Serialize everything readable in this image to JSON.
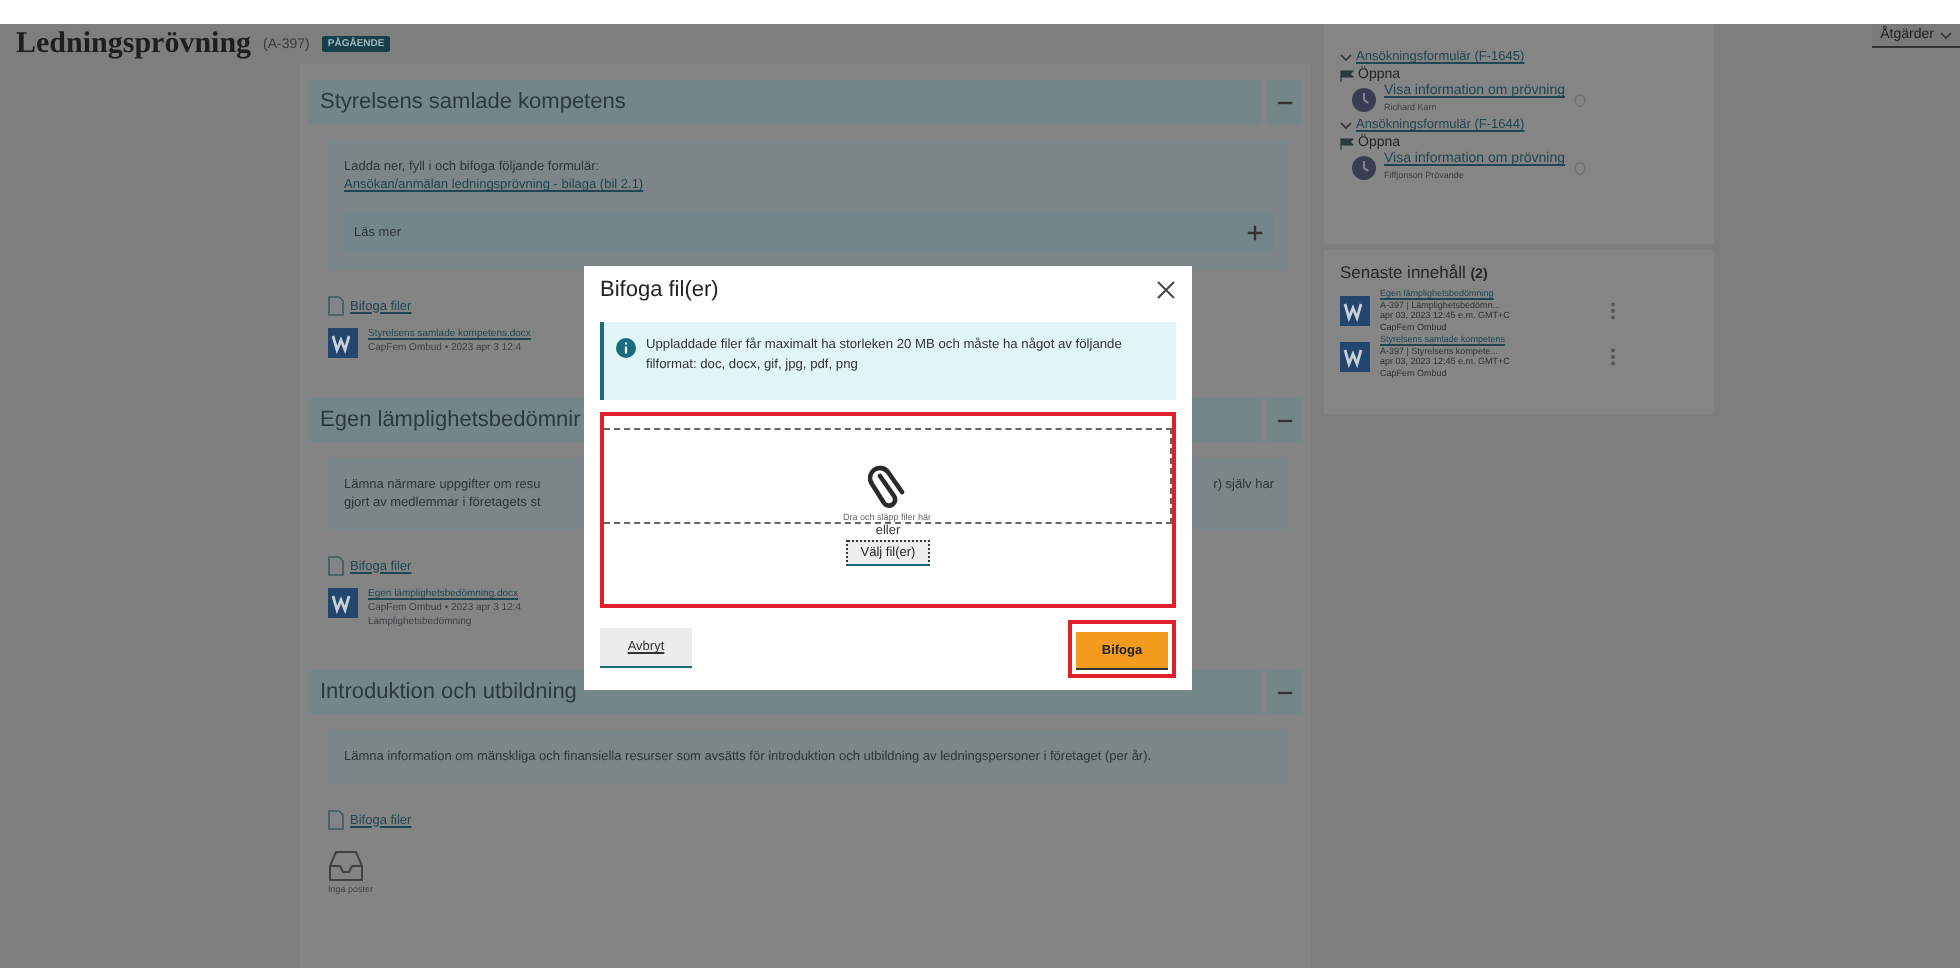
{
  "header": {
    "title": "Ledningsprövning",
    "code": "(A-397)",
    "badge": "PÅGÅENDE"
  },
  "actions_button": {
    "label": "Åtgärder"
  },
  "sections": [
    {
      "heading": "Styrelsens samlade kompetens",
      "expanded": true,
      "description": [
        "Ladda ner, fyll i och bifoga följande formulär:"
      ],
      "form_link": "Ansökan/anmälan ledningsprövning - bilaga (bil 2.1)",
      "read_more": {
        "label": "Läs mer",
        "expanded": false
      },
      "attach": "Bifoga filer",
      "files": [
        {
          "name": "Styrelsens samlade kompetens.docx",
          "meta": "CapFem Ombud •  2023 apr 3 12:4"
        }
      ]
    },
    {
      "heading": "Egen lämplighetsbedömnir",
      "expanded": true,
      "description": [
        "Lämna närmare uppgifter om resu",
        "gjort av medlemmar i företagets st"
      ],
      "description_right": "r) själv har",
      "attach": "Bifoga filer",
      "files": [
        {
          "name": "Egen lämplighetsbedömning.docx",
          "meta": "CapFem Ombud •  2023 apr 3 12:4",
          "category": "Lämplighetsbedömning"
        }
      ]
    },
    {
      "heading": "Introduktion och utbildning",
      "expanded": true,
      "description": [
        "Lämna information om mänskliga och finansiella resurser som avsätts för introduktion och utbildning av ledningspersoner i företaget (per år)."
      ],
      "attach": "Bifoga filer",
      "empty": "Inga poster"
    }
  ],
  "tasks": [
    {
      "form": "Ansökningsformulär (F-1645)",
      "expanded": true,
      "status": "Öppna",
      "link": "Visa information om prövning",
      "person": "Richard Karn"
    },
    {
      "form": "Ansökningsformulär (F-1644)",
      "expanded": true,
      "status": "Öppna",
      "link": "Visa information om prövning",
      "person": "Fiffjonson Prövande"
    }
  ],
  "recent": {
    "title": "Senaste innehåll **(2)**",
    "items": [
      {
        "link": "Egen lämplighetsbedömning",
        "lines": [
          "A-397 | Lämplighetsbedömn...",
          "apr 03, 2023 12:45 e.m. GMT+C",
          "CapFem Ombud"
        ]
      },
      {
        "link": "Styrelsens samlade kompetens",
        "lines": [
          "A-397 | Styrelsens kompete...",
          "apr 03, 2023 12:45 e.m. GMT+C",
          "CapFem Ombud"
        ]
      }
    ]
  },
  "modal": {
    "title": "Bifoga fil(er)",
    "info": "Uppladdade filer får maximalt ha storleken 20 MB och måste ha något av följande filformat: doc, docx, gif, jpg, pdf, png",
    "dropzone": {
      "hint": "Dra och släpp filer här",
      "or": "eller",
      "choose": "Välj fil(er)",
      "highlighted": true
    },
    "cancel": "Avbryt",
    "submit": {
      "label": "Bifoga",
      "highlighted": true
    }
  }
}
